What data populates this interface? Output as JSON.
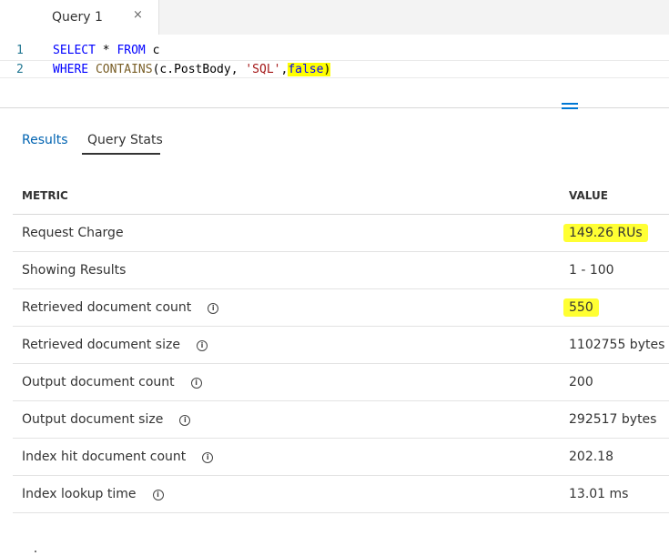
{
  "tab": {
    "label": "Query 1",
    "close": "×"
  },
  "editor": {
    "lines": [
      {
        "number": "1",
        "kw1": "SELECT",
        "mid": " * ",
        "kw2": "FROM",
        "rest": " c"
      },
      {
        "number": "2",
        "kw": "WHERE",
        "fn": "CONTAINS",
        "paren_open": "(",
        "arg": "c.PostBody, ",
        "str": "'SQL'",
        "comma": ",",
        "bool": "false",
        "paren_close": ")"
      }
    ]
  },
  "result_tabs": {
    "results": "Results",
    "stats": "Query Stats"
  },
  "table": {
    "headers": {
      "metric": "METRIC",
      "value": "VALUE"
    },
    "rows": [
      {
        "metric": "Request Charge",
        "value": "149.26 RUs",
        "info": false,
        "highlighted": true
      },
      {
        "metric": "Showing Results",
        "value": "1 - 100",
        "info": false,
        "highlighted": false
      },
      {
        "metric": "Retrieved document count",
        "value": "550",
        "info": true,
        "highlighted": true
      },
      {
        "metric": "Retrieved document size",
        "value": "1102755 bytes",
        "info": true,
        "highlighted": false
      },
      {
        "metric": "Output document count",
        "value": "200",
        "info": true,
        "highlighted": false
      },
      {
        "metric": "Output document size",
        "value": "292517 bytes",
        "info": true,
        "highlighted": false
      },
      {
        "metric": "Index hit document count",
        "value": "202.18",
        "info": true,
        "highlighted": false
      },
      {
        "metric": "Index lookup time",
        "value": "13.01 ms",
        "info": true,
        "highlighted": false
      }
    ]
  },
  "info_icon_glyph": "i",
  "highlight_color": "#ffff00",
  "link_color": "#0063b1"
}
